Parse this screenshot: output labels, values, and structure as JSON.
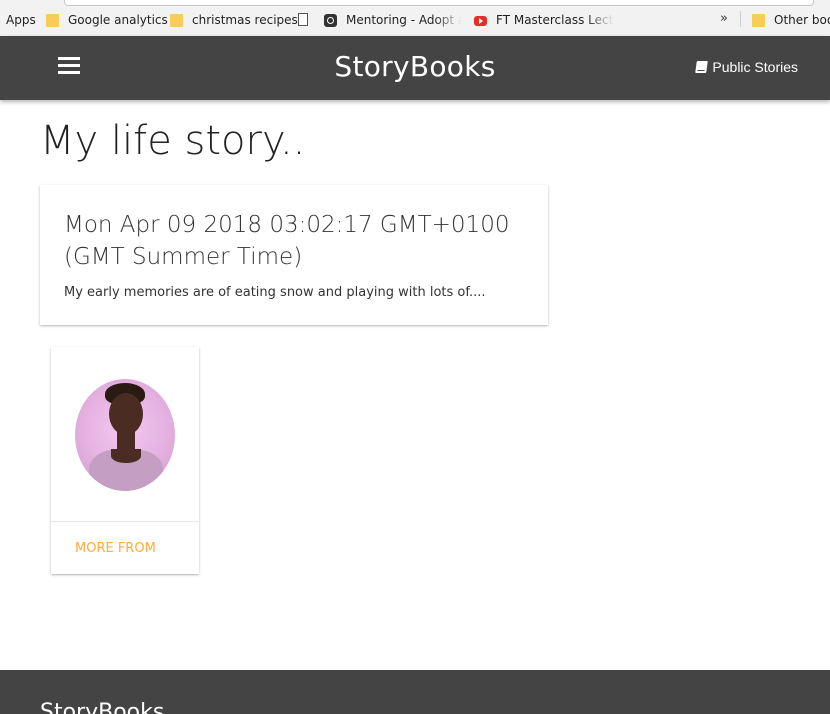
{
  "bookmarks": {
    "apps_label": "Apps",
    "items": [
      {
        "label": "Google analytics",
        "icon": "folder-icon"
      },
      {
        "label": "christmas recipes",
        "icon": "folder-icon"
      },
      {
        "label": "",
        "icon": "page-icon"
      },
      {
        "label": "Mentoring - Adopt a",
        "icon": "instagram-icon"
      },
      {
        "label": "FT Masterclass Lectur",
        "icon": "youtube-icon"
      }
    ],
    "overflow_label": "»",
    "other_label": "Other boo"
  },
  "navbar": {
    "brand": "StoryBooks",
    "public_stories_label": "Public Stories"
  },
  "main": {
    "page_title": "My life story..",
    "story": {
      "date": "Mon Apr 09 2018 03:02:17 GMT+0100 (GMT Summer Time)",
      "excerpt": "My early memories are of eating snow and playing with lots of...."
    },
    "author_card": {
      "more_from_label": "MORE FROM"
    }
  },
  "footer": {
    "brand": "StoryBooks"
  },
  "colors": {
    "navbar": "#444444",
    "accent": "#ffab40",
    "footer": "#444444"
  }
}
